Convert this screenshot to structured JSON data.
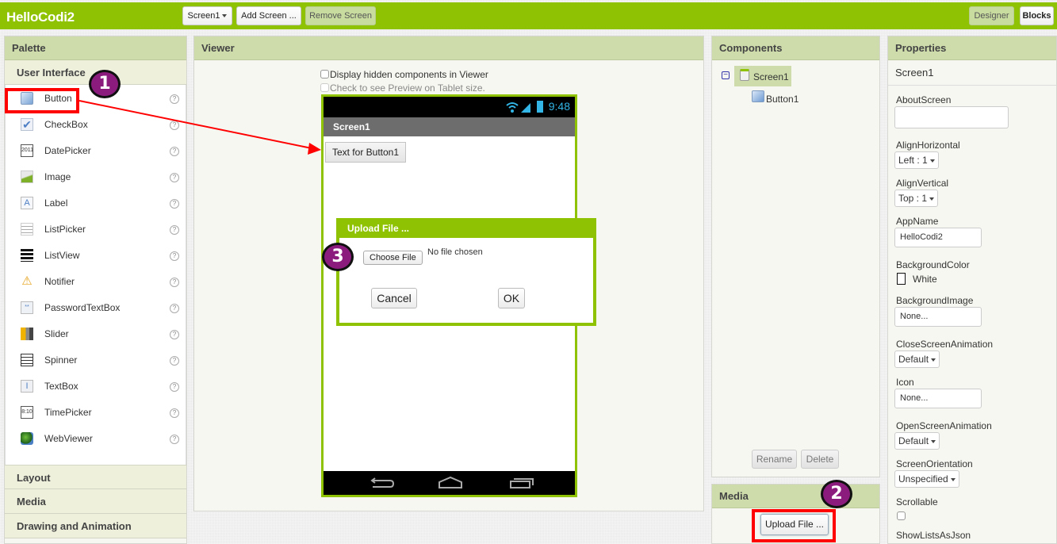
{
  "app": {
    "title": "HelloCodi2",
    "screen_select": "Screen1",
    "add_screen": "Add Screen ...",
    "remove_screen": "Remove Screen",
    "designer": "Designer",
    "blocks": "Blocks"
  },
  "palette": {
    "title": "Palette",
    "section": "User Interface",
    "items": [
      {
        "label": "Button",
        "icon": "button-icon"
      },
      {
        "label": "CheckBox",
        "icon": "checkbox-icon"
      },
      {
        "label": "DatePicker",
        "icon": "datepicker-icon"
      },
      {
        "label": "Image",
        "icon": "image-icon"
      },
      {
        "label": "Label",
        "icon": "label-icon"
      },
      {
        "label": "ListPicker",
        "icon": "listpicker-icon"
      },
      {
        "label": "ListView",
        "icon": "listview-icon"
      },
      {
        "label": "Notifier",
        "icon": "notifier-icon"
      },
      {
        "label": "PasswordTextBox",
        "icon": "password-icon"
      },
      {
        "label": "Slider",
        "icon": "slider-icon"
      },
      {
        "label": "Spinner",
        "icon": "spinner-icon"
      },
      {
        "label": "TextBox",
        "icon": "textbox-icon"
      },
      {
        "label": "TimePicker",
        "icon": "timepicker-icon"
      },
      {
        "label": "WebViewer",
        "icon": "webviewer-icon"
      }
    ],
    "help_glyph": "?",
    "collapsed_sections": [
      "Layout",
      "Media",
      "Drawing and Animation"
    ]
  },
  "viewer": {
    "title": "Viewer",
    "display_hidden": "Display hidden components in Viewer",
    "tablet_preview": "Check to see Preview on Tablet size.",
    "phone": {
      "time": "9:48",
      "screen_title": "Screen1",
      "button_text": "Text for Button1"
    }
  },
  "dialog": {
    "title": "Upload File ...",
    "choose_file": "Choose File",
    "no_file": "No file chosen",
    "cancel": "Cancel",
    "ok": "OK"
  },
  "components": {
    "title": "Components",
    "tree": [
      {
        "label": "Screen1",
        "selected": true
      },
      {
        "label": "Button1",
        "selected": false
      }
    ],
    "collapse_glyph": "−",
    "rename": "Rename",
    "delete": "Delete"
  },
  "media": {
    "title": "Media",
    "upload": "Upload File ..."
  },
  "properties": {
    "title": "Properties",
    "component": "Screen1",
    "about_screen": {
      "label": "AboutScreen",
      "value": ""
    },
    "align_horizontal": {
      "label": "AlignHorizontal",
      "value": "Left : 1"
    },
    "align_vertical": {
      "label": "AlignVertical",
      "value": "Top : 1"
    },
    "app_name": {
      "label": "AppName",
      "value": "HelloCodi2"
    },
    "background_color": {
      "label": "BackgroundColor",
      "value": "White"
    },
    "background_image": {
      "label": "BackgroundImage",
      "value": "None..."
    },
    "close_anim": {
      "label": "CloseScreenAnimation",
      "value": "Default"
    },
    "icon": {
      "label": "Icon",
      "value": "None..."
    },
    "open_anim": {
      "label": "OpenScreenAnimation",
      "value": "Default"
    },
    "orientation": {
      "label": "ScreenOrientation",
      "value": "Unspecified"
    },
    "scrollable": {
      "label": "Scrollable",
      "checked": false
    },
    "show_lists": {
      "label": "ShowListsAsJson"
    }
  },
  "annotations": {
    "step1": "1",
    "step2": "2",
    "step3": "3",
    "highlight_color": "#ff0000",
    "badge_color": "#8b1c7d"
  }
}
